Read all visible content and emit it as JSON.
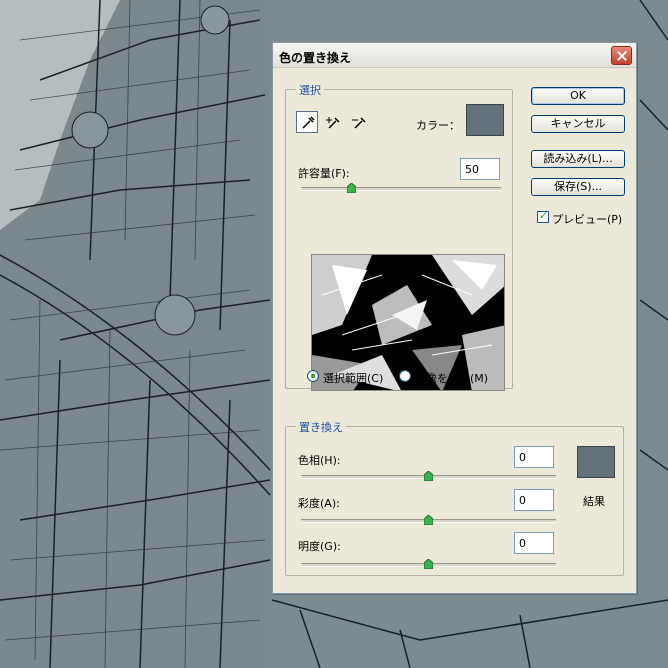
{
  "dialog": {
    "title": "色の置き換え",
    "close_icon": "close-icon"
  },
  "selection": {
    "legend": "選択",
    "tools": [
      "eyedropper-icon",
      "eyedropper-plus-icon",
      "eyedropper-minus-icon"
    ],
    "color_label": "カラー：",
    "color_swatch": "#63727a",
    "fuzziness_label": "許容量(F):",
    "fuzziness_value": "50",
    "fuzziness_level": 0.25,
    "radio_selection_label": "選択範囲(C)",
    "radio_image_label": "画像を表示(M)",
    "selected_radio": "selection"
  },
  "replacement": {
    "legend": "置き換え",
    "hue_label": "色相(H):",
    "hue_value": "0",
    "saturation_label": "彩度(A):",
    "saturation_value": "0",
    "lightness_label": "明度(G):",
    "lightness_value": "0",
    "result_label": "結果",
    "result_swatch": "#63727a"
  },
  "buttons": {
    "ok": "OK",
    "cancel": "キャンセル",
    "load": "読み込み(L)...",
    "save": "保存(S)...",
    "preview_label": "プレビュー(P)",
    "preview_checked": true
  }
}
